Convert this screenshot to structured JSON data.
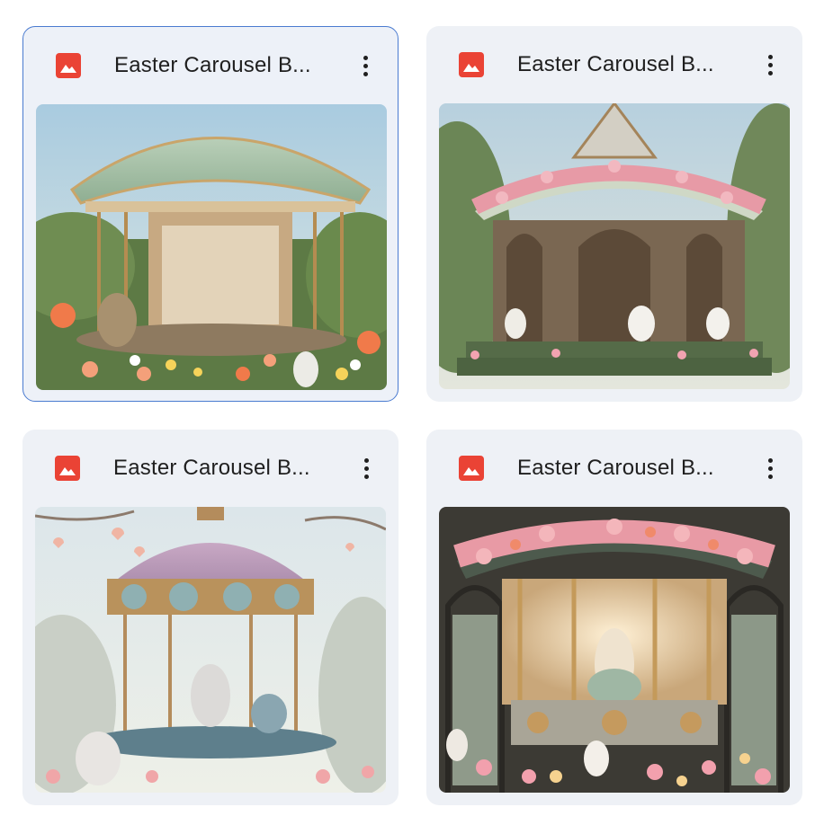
{
  "files": [
    {
      "title": "Easter Carousel B...",
      "icon": "image-file-icon",
      "selected": true
    },
    {
      "title": "Easter Carousel B...",
      "icon": "image-file-icon",
      "selected": false
    },
    {
      "title": "Easter Carousel B...",
      "icon": "image-file-icon",
      "selected": false
    },
    {
      "title": "Easter Carousel B...",
      "icon": "image-file-icon",
      "selected": false
    }
  ],
  "colors": {
    "icon_red": "#ea4335",
    "selected_border": "#4a7bd0",
    "card_bg": "#eef1f6"
  }
}
